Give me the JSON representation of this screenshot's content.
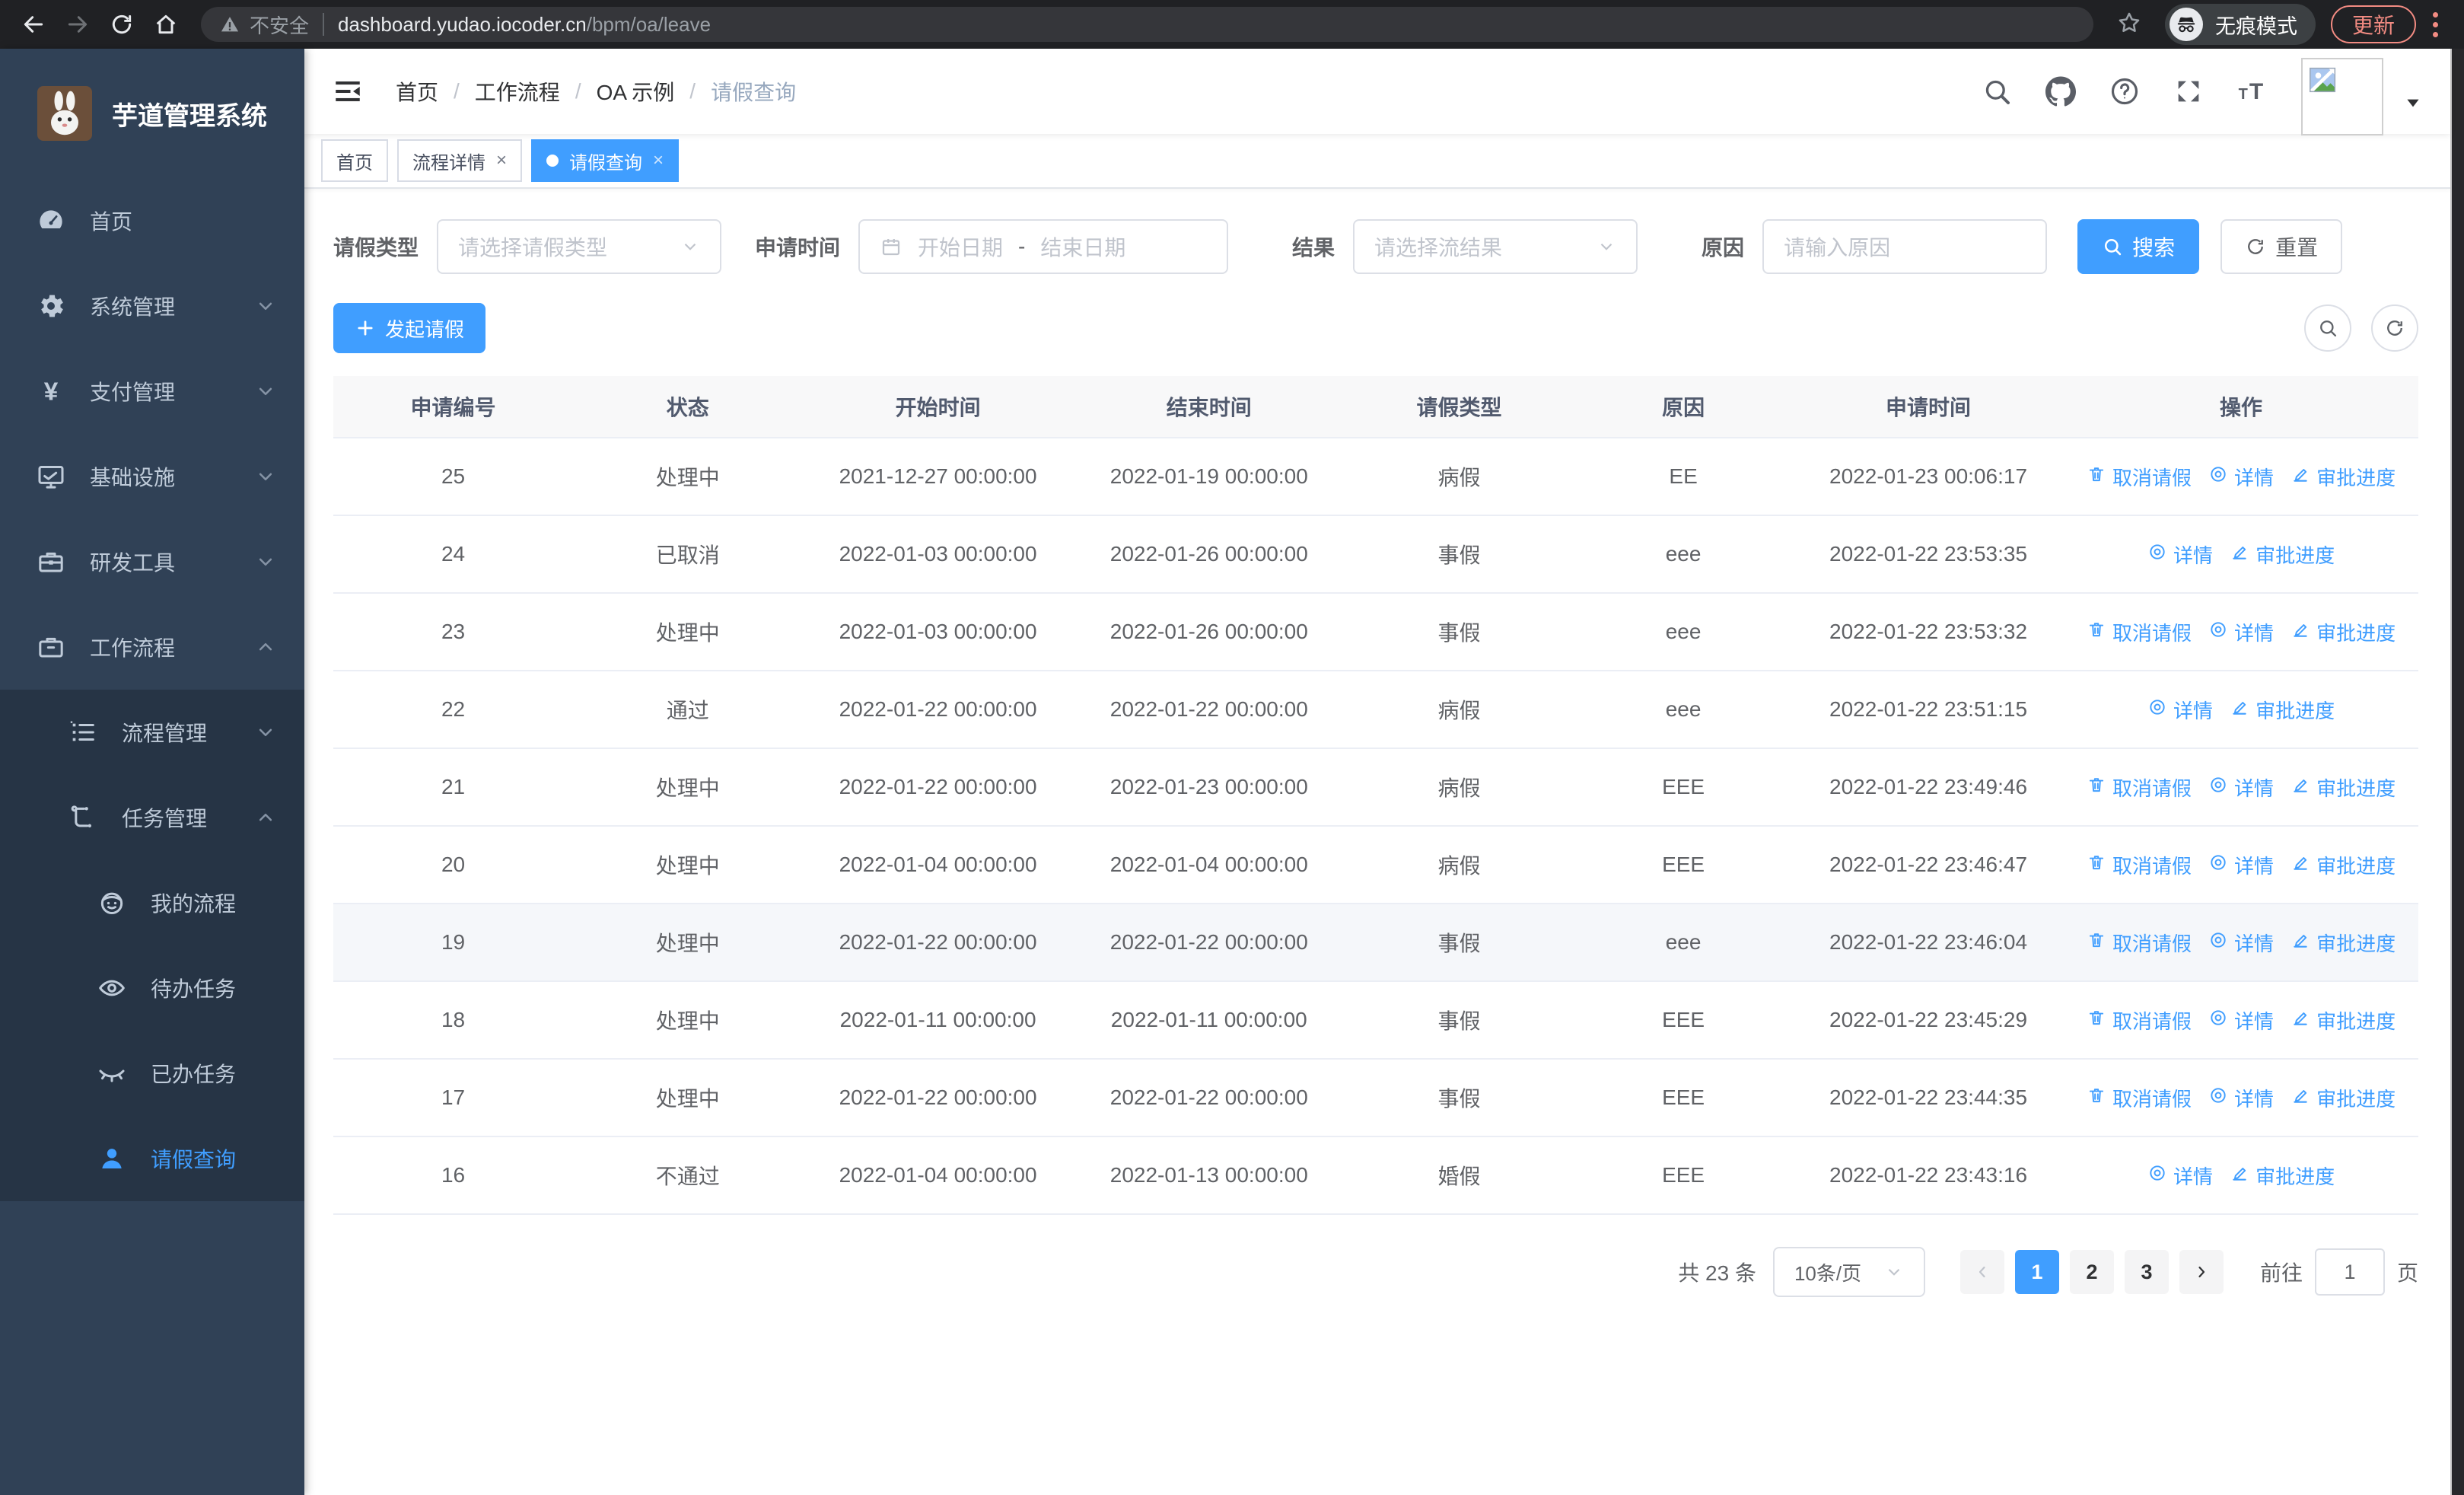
{
  "theme": {
    "accent": "#409eff",
    "sidebar_bg": "#304156",
    "submenu_bg": "#263445",
    "chrome_bg": "#202124",
    "coral": "#f28b82"
  },
  "browser": {
    "security_label": "不安全",
    "url_host": "dashboard.yudao.iocoder.cn",
    "url_path": "/bpm/oa/leave",
    "incognito_label": "无痕模式",
    "update_label": "更新"
  },
  "sidebar": {
    "title": "芋道管理系统",
    "items": [
      {
        "label": "首页",
        "icon": "dashboard-icon",
        "level": 1
      },
      {
        "label": "系统管理",
        "icon": "gear-icon",
        "level": 1,
        "chevron": "down"
      },
      {
        "label": "支付管理",
        "icon": "yen-icon",
        "level": 1,
        "chevron": "down"
      },
      {
        "label": "基础设施",
        "icon": "monitor-icon",
        "level": 1,
        "chevron": "down"
      },
      {
        "label": "研发工具",
        "icon": "toolbox-icon",
        "level": 1,
        "chevron": "down"
      },
      {
        "label": "工作流程",
        "icon": "briefcase-icon",
        "level": 1,
        "chevron": "up",
        "children": [
          {
            "label": "流程管理",
            "icon": "list-icon",
            "level": 2,
            "chevron": "down"
          },
          {
            "label": "任务管理",
            "icon": "tree-icon",
            "level": 2,
            "chevron": "up",
            "children": [
              {
                "label": "我的流程",
                "icon": "robot-face-icon",
                "level": 3
              },
              {
                "label": "待办任务",
                "icon": "eye-open-icon",
                "level": 3
              },
              {
                "label": "已办任务",
                "icon": "eye-closed-icon",
                "level": 3
              },
              {
                "label": "请假查询",
                "icon": "user-icon",
                "level": 3,
                "active": true
              }
            ]
          }
        ]
      }
    ]
  },
  "breadcrumb": [
    "首页",
    "工作流程",
    "OA 示例",
    "请假查询"
  ],
  "tabs": [
    {
      "label": "首页",
      "closable": false,
      "active": false
    },
    {
      "label": "流程详情",
      "closable": true,
      "active": false
    },
    {
      "label": "请假查询",
      "closable": true,
      "active": true
    }
  ],
  "filters": {
    "type_label": "请假类型",
    "type_placeholder": "请选择请假类型",
    "time_label": "申请时间",
    "start_placeholder": "开始日期",
    "range_separator": "-",
    "end_placeholder": "结束日期",
    "result_label": "结果",
    "result_placeholder": "请选择流结果",
    "reason_label": "原因",
    "reason_placeholder": "请输入原因",
    "search_label": "搜索",
    "reset_label": "重置"
  },
  "toolbar": {
    "create_label": "发起请假"
  },
  "table": {
    "columns": [
      {
        "label": "申请编号",
        "width": "11.5%"
      },
      {
        "label": "状态",
        "width": "11%"
      },
      {
        "label": "开始时间",
        "width": "13%"
      },
      {
        "label": "结束时间",
        "width": "13%"
      },
      {
        "label": "请假类型",
        "width": "11%"
      },
      {
        "label": "原因",
        "width": "10.5%"
      },
      {
        "label": "申请时间",
        "width": "13%"
      },
      {
        "label": "操作",
        "width": "17%"
      }
    ],
    "action_labels": {
      "cancel": "取消请假",
      "detail": "详情",
      "progress": "审批进度"
    },
    "rows": [
      {
        "id": "25",
        "status": "处理中",
        "start": "2021-12-27 00:00:00",
        "end": "2022-01-19 00:00:00",
        "type": "病假",
        "reason": "EE",
        "applied": "2022-01-23 00:06:17",
        "actions": [
          "cancel",
          "detail",
          "progress"
        ],
        "hovered": false
      },
      {
        "id": "24",
        "status": "已取消",
        "start": "2022-01-03 00:00:00",
        "end": "2022-01-26 00:00:00",
        "type": "事假",
        "reason": "eee",
        "applied": "2022-01-22 23:53:35",
        "actions": [
          "detail",
          "progress"
        ],
        "hovered": false
      },
      {
        "id": "23",
        "status": "处理中",
        "start": "2022-01-03 00:00:00",
        "end": "2022-01-26 00:00:00",
        "type": "事假",
        "reason": "eee",
        "applied": "2022-01-22 23:53:32",
        "actions": [
          "cancel",
          "detail",
          "progress"
        ],
        "hovered": false
      },
      {
        "id": "22",
        "status": "通过",
        "start": "2022-01-22 00:00:00",
        "end": "2022-01-22 00:00:00",
        "type": "病假",
        "reason": "eee",
        "applied": "2022-01-22 23:51:15",
        "actions": [
          "detail",
          "progress"
        ],
        "hovered": false
      },
      {
        "id": "21",
        "status": "处理中",
        "start": "2022-01-22 00:00:00",
        "end": "2022-01-23 00:00:00",
        "type": "病假",
        "reason": "EEE",
        "applied": "2022-01-22 23:49:46",
        "actions": [
          "cancel",
          "detail",
          "progress"
        ],
        "hovered": false
      },
      {
        "id": "20",
        "status": "处理中",
        "start": "2022-01-04 00:00:00",
        "end": "2022-01-04 00:00:00",
        "type": "病假",
        "reason": "EEE",
        "applied": "2022-01-22 23:46:47",
        "actions": [
          "cancel",
          "detail",
          "progress"
        ],
        "hovered": false
      },
      {
        "id": "19",
        "status": "处理中",
        "start": "2022-01-22 00:00:00",
        "end": "2022-01-22 00:00:00",
        "type": "事假",
        "reason": "eee",
        "applied": "2022-01-22 23:46:04",
        "actions": [
          "cancel",
          "detail",
          "progress"
        ],
        "hovered": true
      },
      {
        "id": "18",
        "status": "处理中",
        "start": "2022-01-11 00:00:00",
        "end": "2022-01-11 00:00:00",
        "type": "事假",
        "reason": "EEE",
        "applied": "2022-01-22 23:45:29",
        "actions": [
          "cancel",
          "detail",
          "progress"
        ],
        "hovered": false
      },
      {
        "id": "17",
        "status": "处理中",
        "start": "2022-01-22 00:00:00",
        "end": "2022-01-22 00:00:00",
        "type": "事假",
        "reason": "EEE",
        "applied": "2022-01-22 23:44:35",
        "actions": [
          "cancel",
          "detail",
          "progress"
        ],
        "hovered": false
      },
      {
        "id": "16",
        "status": "不通过",
        "start": "2022-01-04 00:00:00",
        "end": "2022-01-13 00:00:00",
        "type": "婚假",
        "reason": "EEE",
        "applied": "2022-01-22 23:43:16",
        "actions": [
          "detail",
          "progress"
        ],
        "hovered": false
      }
    ]
  },
  "pagination": {
    "total_label": "共 23 条",
    "page_size": "10条/页",
    "pages": [
      "1",
      "2",
      "3"
    ],
    "current": "1",
    "goto_label": "前往",
    "goto_value": "1",
    "page_suffix": "页"
  }
}
